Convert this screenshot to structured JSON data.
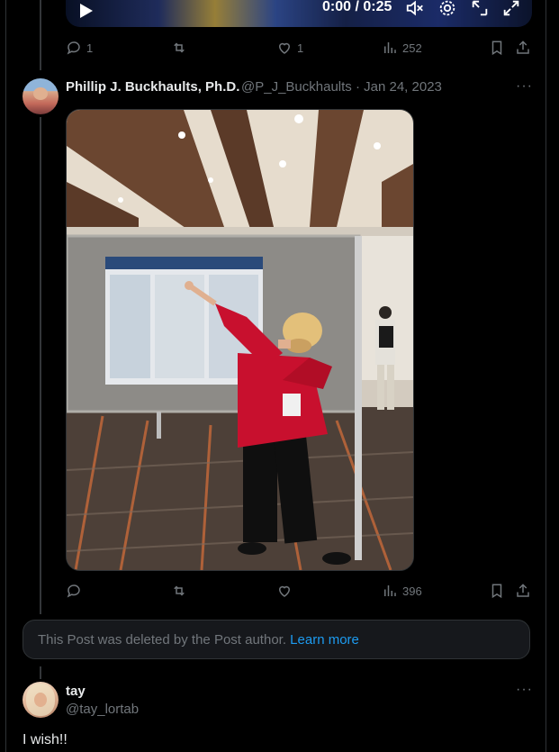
{
  "video": {
    "time": "0:00 / 0:25",
    "icons": [
      "play-icon",
      "mute-icon",
      "gear-icon",
      "exit-icon",
      "fullscreen-icon"
    ]
  },
  "post1_actions": {
    "replies": "1",
    "reposts": "",
    "likes": "1",
    "views": "252"
  },
  "post2": {
    "name": "Phillip J. Buckhaults, Ph.D.",
    "handle": "@P_J_Buckhaults",
    "sep": "·",
    "date": "Jan 24, 2023",
    "more": "···",
    "photo_description_colors": {
      "shirt": "#c8102e",
      "floor": "#5a4a3e",
      "board": "#8a8a86"
    },
    "actions": {
      "replies": "",
      "reposts": "",
      "likes": "",
      "views": "396"
    }
  },
  "deleted_notice": {
    "text": "This Post was deleted by the Post author.",
    "link": "Learn more"
  },
  "reply": {
    "name": "tay",
    "handle": "@tay_lortab",
    "more": "···",
    "text": "I wish!!"
  },
  "colors": {
    "accent": "#1d9bf0",
    "muted": "#71767b",
    "text": "#e7e9ea",
    "bg": "#000000"
  }
}
